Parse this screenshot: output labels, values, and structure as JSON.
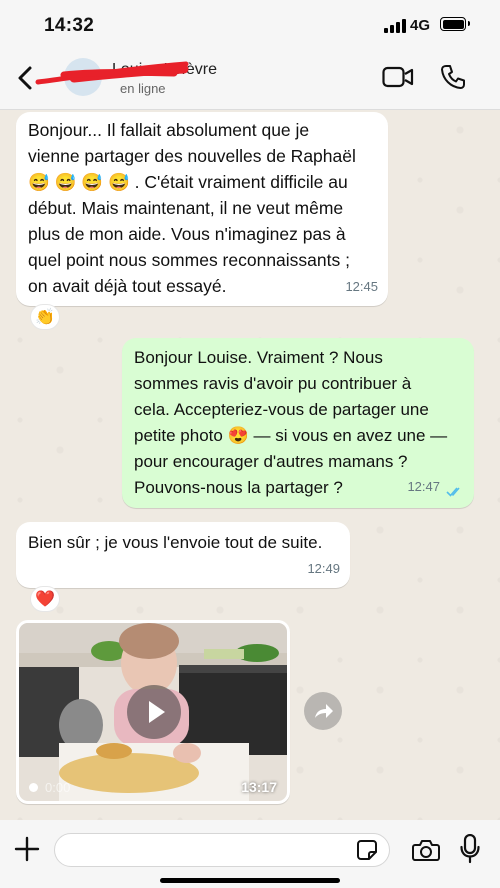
{
  "status_bar": {
    "time": "14:32",
    "network": "4G"
  },
  "header": {
    "contact_name": "Louise Lefèvre",
    "contact_status": "en ligne",
    "icons": [
      "back-icon",
      "video-call-icon",
      "phone-icon"
    ]
  },
  "messages": [
    {
      "direction": "incoming",
      "lines": [
        "Bonjour... Il fallait absolument que je",
        "vienne partager des nouvelles de Raphaël",
        "😅 😅 😅 😅 . C'était vraiment difficile au",
        "début. Mais maintenant, il ne veut même",
        "plus de mon aide. Vous n'imaginez pas à",
        "quel point nous sommes reconnaissants ;",
        "on avait déjà tout essayé."
      ],
      "time": "12:45",
      "reaction": "👏"
    },
    {
      "direction": "outgoing",
      "lines": [
        "Bonjour Louise. Vraiment ? Nous",
        "sommes ravis d'avoir pu contribuer à",
        "cela. Accepteriez-vous de partager une",
        "petite photo 😍 — si vous en avez une —",
        "pour encourager d'autres mamans ?",
        "Pouvons-nous la partager ?"
      ],
      "time": "12:47",
      "read": true
    },
    {
      "direction": "incoming",
      "lines": [
        "Bien sûr ; je vous l'envoie tout de suite."
      ],
      "time": "12:49",
      "reaction": "❤️"
    }
  ],
  "video": {
    "elapsed": "0:00",
    "duration": "13:17"
  },
  "composer": {
    "placeholder": ""
  },
  "colors": {
    "incoming": "#ffffff",
    "outgoing": "#d9fdd3",
    "background": "#efeae2",
    "read_ticks": "#53bdeb"
  }
}
